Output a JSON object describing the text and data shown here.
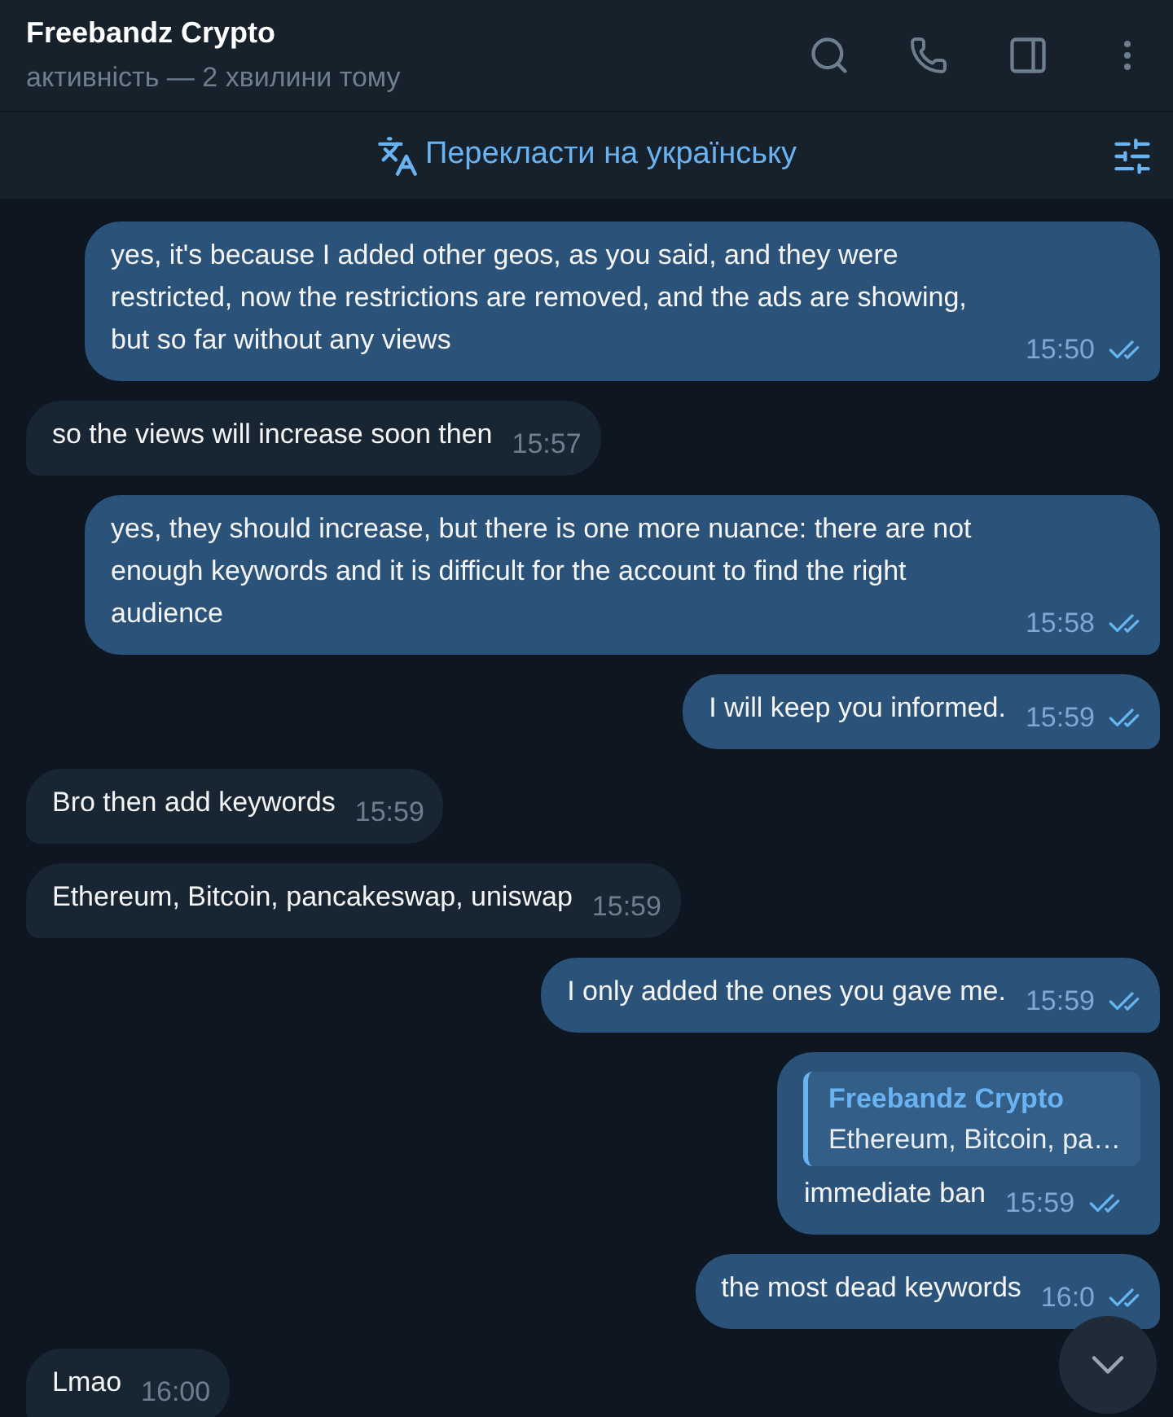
{
  "header": {
    "title": "Freebandz Crypto",
    "status": "активність — 2 хвилини тому"
  },
  "translate_bar": {
    "label": "Перекласти на українську"
  },
  "messages": [
    {
      "kind": "text",
      "outgoing": true,
      "text": "yes, it's because I added other geos, as you said, and they were restricted, now the restrictions are removed, and the ads are showing, but so far without any views",
      "time": "15:50",
      "read": true
    },
    {
      "kind": "text",
      "outgoing": false,
      "text": "so the views will increase soon then",
      "time": "15:57"
    },
    {
      "kind": "text",
      "outgoing": true,
      "text": "yes, they should increase, but there is one more nuance: there are not enough keywords and it is difficult for the account to find the right audience",
      "time": "15:58",
      "read": true
    },
    {
      "kind": "text",
      "outgoing": true,
      "text": "I will keep you informed.",
      "time": "15:59",
      "read": true
    },
    {
      "kind": "text",
      "outgoing": false,
      "text": "Bro then add keywords",
      "time": "15:59"
    },
    {
      "kind": "text",
      "outgoing": false,
      "text": "Ethereum, Bitcoin, pancakeswap, uniswap",
      "time": "15:59"
    },
    {
      "kind": "text",
      "outgoing": true,
      "text": "I only added the ones you gave me.",
      "time": "15:59",
      "read": true
    },
    {
      "kind": "reply",
      "outgoing": true,
      "reply": {
        "author": "Freebandz Crypto",
        "text": "Ethereum, Bitcoin, pa…"
      },
      "text": "immediate ban",
      "time": "15:59",
      "read": true
    },
    {
      "kind": "text",
      "outgoing": true,
      "text": "the most dead keywords",
      "time": "16:0",
      "read": true
    },
    {
      "kind": "text",
      "outgoing": false,
      "text": "Lmao",
      "time": "16:00"
    }
  ]
}
